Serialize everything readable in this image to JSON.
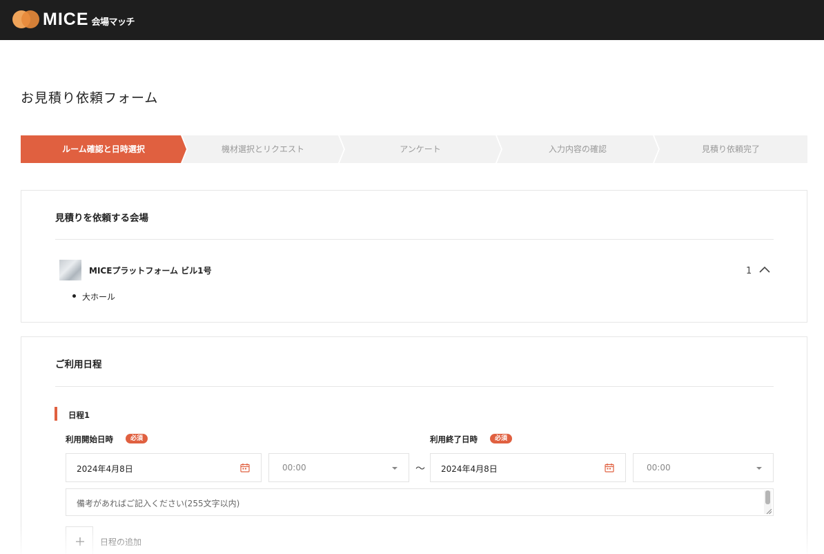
{
  "header": {
    "logo_text": "MICE",
    "logo_sub": "会場マッチ"
  },
  "page": {
    "title": "お見積り依頼フォーム"
  },
  "steps": [
    {
      "label": "ルーム確認と日時選択",
      "active": true
    },
    {
      "label": "機材選択とリクエスト",
      "active": false
    },
    {
      "label": "アンケート",
      "active": false
    },
    {
      "label": "入力内容の確認",
      "active": false
    },
    {
      "label": "見積り依頼完了",
      "active": false
    }
  ],
  "venue_section": {
    "title": "見積りを依頼する会場",
    "venue_name": "MICEプラットフォーム ビル1号",
    "count": "1",
    "rooms": [
      "大ホール"
    ]
  },
  "schedule_section": {
    "title": "ご利用日程",
    "schedule_label": "日程1",
    "start_label": "利用開始日時",
    "end_label": "利用終了日時",
    "required_badge": "必須",
    "start_date": "2024年4月8日",
    "start_time": "00:00",
    "separator": "〜",
    "end_date": "2024年4月8日",
    "end_time": "00:00",
    "notes_placeholder": "備考があればご記入ください(255文字以内)",
    "add_label": "日程の追加"
  },
  "colors": {
    "accent": "#e06040",
    "header_bg": "#1e1e1e",
    "step_inactive": "#f2f2f2"
  }
}
